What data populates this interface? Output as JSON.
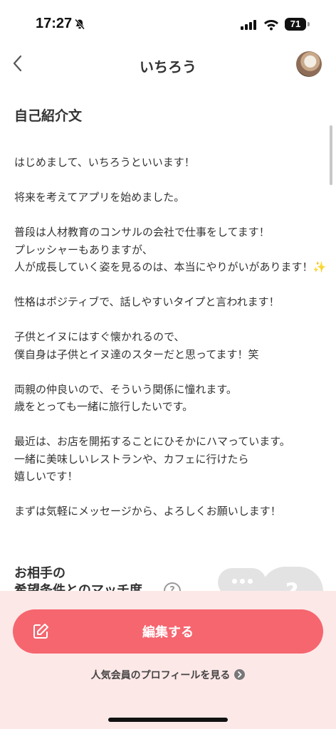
{
  "status_bar": {
    "time": "17:27",
    "battery": "71"
  },
  "header": {
    "title": "いちろう"
  },
  "bio_section": {
    "heading": "自己紹介文",
    "paragraphs": [
      "はじめまして、いちろうといいます！",
      "将来を考えてアプリを始めました。",
      "普段は人材教育のコンサルの会社で仕事をしてます！\nプレッシャーもありますが、\n人が成長していく姿を見るのは、本当にやりがいがあります！✨",
      "性格はポジティブで、話しやすいタイプと言われます！",
      "子供とイヌにはすぐ懐かれるので、\n僕自身は子供とイヌ達のスターだと思ってます！笑",
      "両親の仲良いので、そういう関係に憧れます。\n歳をとっても一緒に旅行したいです。",
      "最近は、お店を開拓することにひそかにハマっています。\n一緒に美味しいレストランや、カフェに行けたら\n嬉しいです！",
      "まずは気軽にメッセージから、よろしくお願いします！"
    ]
  },
  "match_section": {
    "heading_line1": "お相手の",
    "heading_line2": "希望条件とのマッチ度",
    "help": "?",
    "bubble_mark": "?"
  },
  "actions": {
    "edit_label": "編集する",
    "popular_link": "人気会員のプロフィールを見る"
  },
  "colors": {
    "accent": "#f5666f",
    "panel_bg": "#fde8e8"
  }
}
